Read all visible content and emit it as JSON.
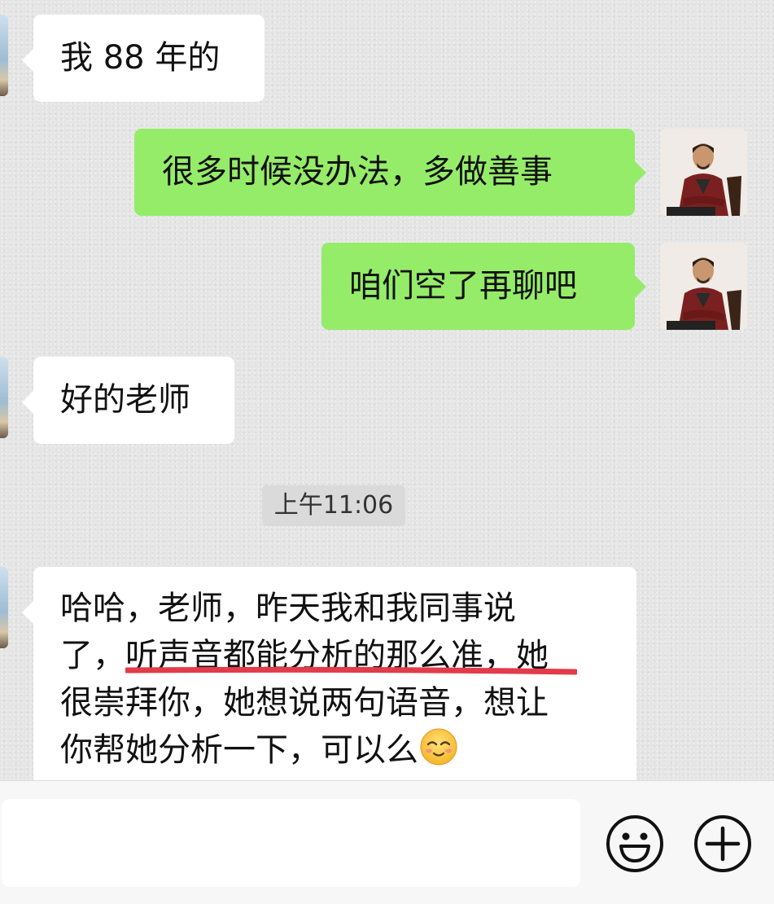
{
  "messages": [
    {
      "side": "in",
      "text": "我 88 年的"
    },
    {
      "side": "out",
      "text": "很多时候没办法，多做善事"
    },
    {
      "side": "out",
      "text": "咱们空了再聊吧"
    },
    {
      "side": "in",
      "text": "好的老师"
    },
    {
      "side": "in",
      "lines": [
        "哈哈，老师，昨天我和我同事说",
        "了，听声音都能分析的那么准，她",
        "很崇拜你，她想说两句语音，想让",
        "你帮她分析一下，可以么"
      ],
      "emoji": "smiling-face-icon",
      "highlight": "听声音都能分析的那么准，"
    }
  ],
  "timestamp": "上午11:06",
  "input": {
    "value": "",
    "placeholder": ""
  },
  "icons": {
    "emoji_button": "emoji-icon",
    "more_button": "plus-icon"
  },
  "colors": {
    "outgoing_bubble": "#95ec69",
    "incoming_bubble": "#ffffff",
    "highlight_underline": "#e23b4a"
  }
}
